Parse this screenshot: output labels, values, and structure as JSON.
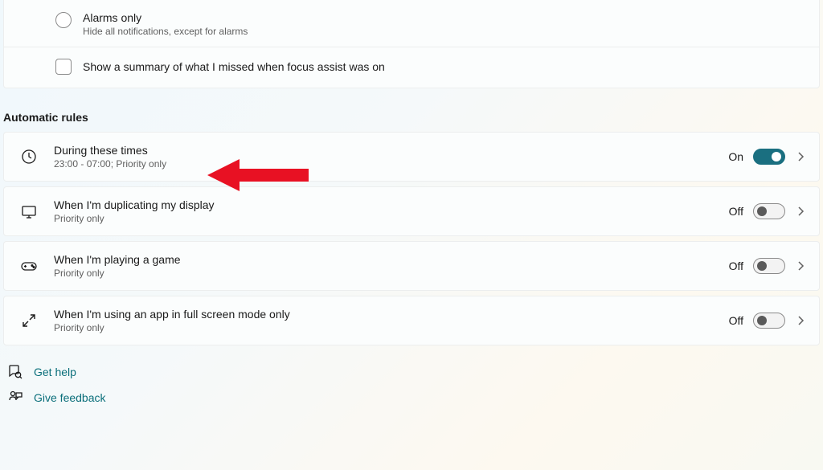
{
  "topCard": {
    "radio": {
      "title": "Alarms only",
      "subtitle": "Hide all notifications, except for alarms"
    },
    "checkbox": {
      "label": "Show a summary of what I missed when focus assist was on"
    }
  },
  "sectionTitle": "Automatic rules",
  "rules": [
    {
      "title": "During these times",
      "subtitle": "23:00 - 07:00; Priority only",
      "stateLabel": "On",
      "on": true
    },
    {
      "title": "When I'm duplicating my display",
      "subtitle": "Priority only",
      "stateLabel": "Off",
      "on": false
    },
    {
      "title": "When I'm playing a game",
      "subtitle": "Priority only",
      "stateLabel": "Off",
      "on": false
    },
    {
      "title": "When I'm using an app in full screen mode only",
      "subtitle": "Priority only",
      "stateLabel": "Off",
      "on": false
    }
  ],
  "footer": {
    "help": "Get help",
    "feedback": "Give feedback"
  }
}
